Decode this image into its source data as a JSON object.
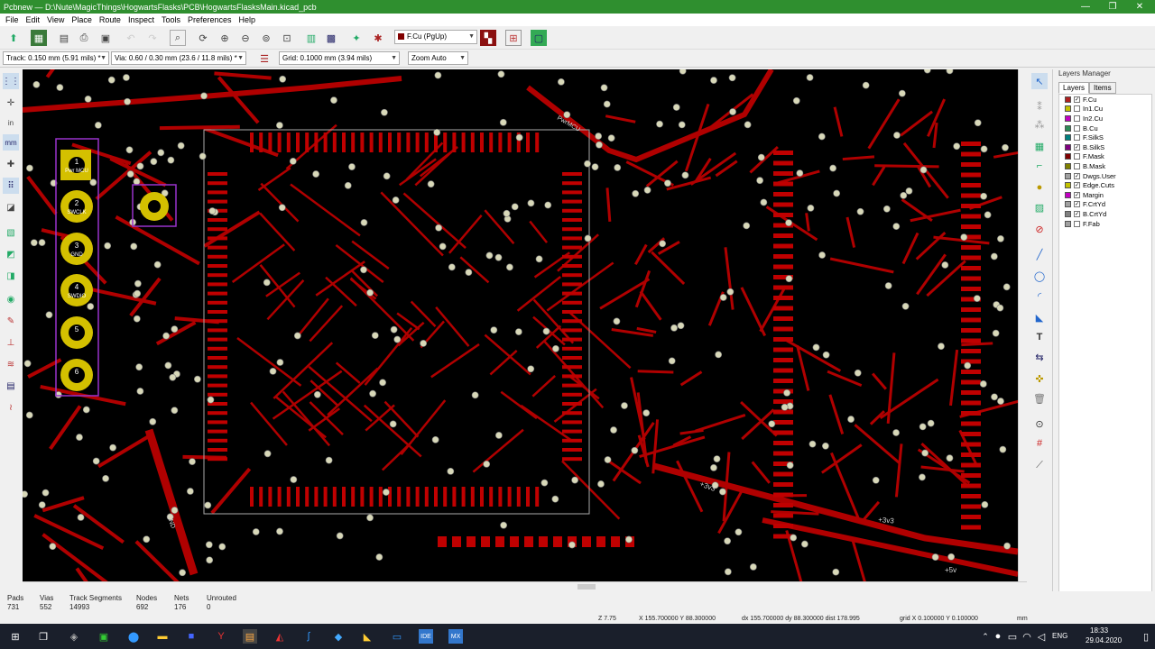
{
  "window": {
    "title": "Pcbnew — D:\\Nute\\MagicThings\\HogwartsFlasks\\PCB\\HogwartsFlasksMain.kicad_pcb",
    "minimize": "—",
    "restore": "❐",
    "close": "✕"
  },
  "menu": [
    "File",
    "Edit",
    "View",
    "Place",
    "Route",
    "Inspect",
    "Tools",
    "Preferences",
    "Help"
  ],
  "toolbar": {
    "layer_select": "F.Cu (PgUp)",
    "track": "Track: 0.150 mm (5.91 mils) *",
    "via": "Via: 0.60 / 0.30 mm (23.6 / 11.8 mils) *",
    "grid": "Grid: 0.1000 mm (3.94 mils)",
    "zoom": "Zoom Auto"
  },
  "layers_manager": {
    "title": "Layers Manager",
    "tabs": [
      "Layers",
      "Items"
    ],
    "layers": [
      {
        "name": "F.Cu",
        "color": "#b02020",
        "checked": true
      },
      {
        "name": "In1.Cu",
        "color": "#c2c200",
        "checked": false
      },
      {
        "name": "In2.Cu",
        "color": "#c200c2",
        "checked": false
      },
      {
        "name": "B.Cu",
        "color": "#2e8b57",
        "checked": false
      },
      {
        "name": "F.SilkS",
        "color": "#008080",
        "checked": false
      },
      {
        "name": "B.SilkS",
        "color": "#800080",
        "checked": true
      },
      {
        "name": "F.Mask",
        "color": "#800000",
        "checked": false
      },
      {
        "name": "B.Mask",
        "color": "#808000",
        "checked": false
      },
      {
        "name": "Dwgs.User",
        "color": "#a0a0a0",
        "checked": true
      },
      {
        "name": "Edge.Cuts",
        "color": "#c2c200",
        "checked": true
      },
      {
        "name": "Margin",
        "color": "#c200c2",
        "checked": true
      },
      {
        "name": "F.CrtYd",
        "color": "#a0a0a0",
        "checked": true
      },
      {
        "name": "B.CrtYd",
        "color": "#808080",
        "checked": true
      },
      {
        "name": "F.Fab",
        "color": "#a0a0a0",
        "checked": false
      }
    ]
  },
  "pcb": {
    "connector_labels": [
      "1",
      "2",
      "3",
      "4",
      "5",
      "6"
    ],
    "connector_texts": [
      "Pwr MCU",
      "SWCLK",
      "GND",
      "SWDIO",
      "",
      ""
    ],
    "net_labels": [
      "+3v3",
      "+3v3",
      "+5v",
      "GND",
      "PwrMCU"
    ],
    "colors": {
      "copper": "#b00000",
      "pad": "#c00000",
      "via": "#d8d8b8",
      "silk": "#9932cc",
      "gold": "#d4c000",
      "edge": "#b0b0b0"
    }
  },
  "status": {
    "pads_label": "Pads",
    "pads": "731",
    "vias_label": "Vias",
    "vias": "552",
    "tracks_label": "Track Segments",
    "tracks": "14993",
    "nodes_label": "Nodes",
    "nodes": "692",
    "nets_label": "Nets",
    "nets": "176",
    "unrouted_label": "Unrouted",
    "unrouted": "0",
    "zoom": "Z 7.75",
    "xy": "X 155.700000  Y 88.300000",
    "dxy": "dx 155.700000  dy 88.300000  dist 178.995",
    "grid": "grid X 0.100000  Y 0.100000",
    "units": "mm"
  },
  "taskbar": {
    "lang": "ENG",
    "time": "18:33",
    "date": "29.04.2020"
  }
}
